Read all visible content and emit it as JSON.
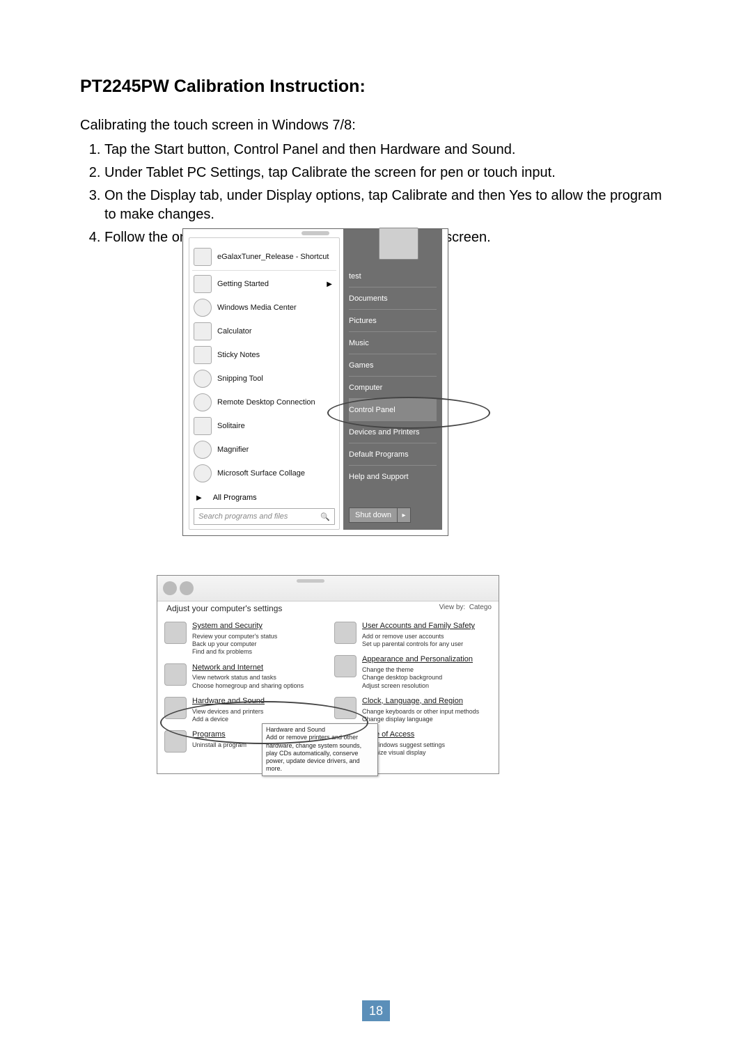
{
  "title": "PT2245PW Calibration Instruction:",
  "intro": "Calibrating the touch screen in Windows 7/8:",
  "steps": [
    "Tap the Start button, Control Panel and then Hardware and Sound.",
    "Under Tablet PC Settings, tap Calibrate the screen for pen or touch input.",
    "On the Display tab, under Display options, tap Calibrate and then Yes to allow the program to make changes.",
    "Follow the on-screen instructions to calibrate the touch screen."
  ],
  "start_menu": {
    "left_items": [
      "eGalaxTuner_Release - Shortcut",
      "Getting Started",
      "Windows Media Center",
      "Calculator",
      "Sticky Notes",
      "Snipping Tool",
      "Remote Desktop Connection",
      "Solitaire",
      "Magnifier",
      "Microsoft Surface Collage"
    ],
    "getting_started_has_submenu": true,
    "all_programs": "All Programs",
    "search_placeholder": "Search programs and files",
    "right_items": [
      "test",
      "Documents",
      "Pictures",
      "Music",
      "Games",
      "Computer",
      "Control Panel",
      "Devices and Printers",
      "Default Programs",
      "Help and Support"
    ],
    "shutdown": "Shut down",
    "highlighted": "Control Panel"
  },
  "control_panel": {
    "heading": "Adjust your computer's settings",
    "view_by_label": "View by:",
    "view_by_value": "Catego",
    "left_categories": [
      {
        "title": "System and Security",
        "links": [
          "Review your computer's status",
          "Back up your computer",
          "Find and fix problems"
        ]
      },
      {
        "title": "Network and Internet",
        "links": [
          "View network status and tasks",
          "Choose homegroup and sharing options"
        ]
      },
      {
        "title": "Hardware and Sound",
        "links": [
          "View devices and printers",
          "Add a device"
        ]
      },
      {
        "title": "Programs",
        "links": [
          "Uninstall a program"
        ]
      }
    ],
    "right_categories": [
      {
        "title": "User Accounts and Family Safety",
        "links": [
          "Add or remove user accounts",
          "Set up parental controls for any user"
        ]
      },
      {
        "title": "Appearance and Personalization",
        "links": [
          "Change the theme",
          "Change desktop background",
          "Adjust screen resolution"
        ]
      },
      {
        "title": "Clock, Language, and Region",
        "links": [
          "Change keyboards or other input methods",
          "Change display language"
        ]
      },
      {
        "title": "Ease of Access",
        "links": [
          "Let Windows suggest settings",
          "Optimize visual display"
        ]
      }
    ],
    "tooltip_title": "Hardware and Sound",
    "tooltip_body": "Add or remove printers and other hardware, change system sounds, play CDs automatically, conserve power, update device drivers, and more.",
    "highlighted": "Hardware and Sound"
  },
  "page_number": "18"
}
